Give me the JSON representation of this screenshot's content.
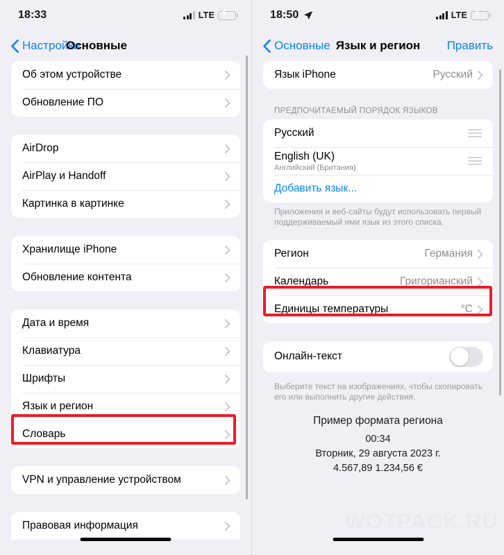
{
  "left_panel": {
    "status_bar": {
      "time": "18:33",
      "carrier": "LTE",
      "signal_bars_filled": 3,
      "signal_bars_total": 4,
      "battery_charging": true,
      "location_arrow": false
    },
    "nav": {
      "back_label": "Настройки",
      "title": "Основные",
      "action_label": ""
    },
    "groups": [
      {
        "rows": [
          {
            "label": "Об этом устройстве",
            "value": "",
            "accessory": "chevron"
          },
          {
            "label": "Обновление ПО",
            "value": "",
            "accessory": "chevron"
          }
        ]
      },
      {
        "rows": [
          {
            "label": "AirDrop",
            "value": "",
            "accessory": "chevron"
          },
          {
            "label": "AirPlay и Handoff",
            "value": "",
            "accessory": "chevron"
          },
          {
            "label": "Картинка в картинке",
            "value": "",
            "accessory": "chevron"
          }
        ]
      },
      {
        "rows": [
          {
            "label": "Хранилище iPhone",
            "value": "",
            "accessory": "chevron"
          },
          {
            "label": "Обновление контента",
            "value": "",
            "accessory": "chevron"
          }
        ]
      },
      {
        "rows": [
          {
            "label": "Дата и время",
            "value": "",
            "accessory": "chevron"
          },
          {
            "label": "Клавиатура",
            "value": "",
            "accessory": "chevron"
          },
          {
            "label": "Шрифты",
            "value": "",
            "accessory": "chevron"
          },
          {
            "label": "Язык и регион",
            "value": "",
            "accessory": "chevron",
            "highlighted": true
          },
          {
            "label": "Словарь",
            "value": "",
            "accessory": "chevron"
          }
        ]
      },
      {
        "rows": [
          {
            "label": "VPN и управление устройством",
            "value": "",
            "accessory": "chevron"
          }
        ]
      },
      {
        "rows": [
          {
            "label": "Правовая информация",
            "value": "",
            "accessory": "chevron"
          }
        ]
      }
    ]
  },
  "right_panel": {
    "status_bar": {
      "time": "18:50",
      "carrier": "LTE",
      "signal_bars_filled": 4,
      "signal_bars_total": 4,
      "battery_charging": true,
      "location_arrow": true
    },
    "nav": {
      "back_label": "Основные",
      "title": "Язык и регион",
      "action_label": "Править"
    },
    "iphone_language": {
      "label": "Язык iPhone",
      "value": "Русский"
    },
    "preferred_order": {
      "caption": "ПРЕДПОЧИТАЕМЫЙ ПОРЯДОК ЯЗЫКОВ",
      "items": [
        {
          "label": "Русский",
          "sub": ""
        },
        {
          "label": "English (UK)",
          "sub": "Английский (Британия)"
        }
      ],
      "add_language_label": "Добавить язык...",
      "footnote": "Приложения и веб-сайты будут использовать первый поддерживаемый ими язык из этого списка."
    },
    "region_group": {
      "rows": [
        {
          "label": "Регион",
          "value": "Германия",
          "highlighted": true
        },
        {
          "label": "Календарь",
          "value": "Григорианский"
        },
        {
          "label": "Единицы температуры",
          "value": "°C"
        }
      ]
    },
    "live_text": {
      "label": "Онлайн-текст",
      "enabled": false,
      "footnote": "Выберите текст на изображениях, чтобы скопировать его или выполнить другие действия."
    },
    "region_sample": {
      "title": "Пример формата региона",
      "time": "00:34",
      "date": "Вторник, 29 августа 2023 г.",
      "numbers": "4.567,89 1.234,56 €"
    }
  },
  "watermark": "WOTPACK.RU",
  "colors": {
    "accent_blue": "#0a84ff",
    "highlight_red": "#ee1c25",
    "background_gray": "#f0eff5",
    "card_white": "#ffffff",
    "secondary_text": "#8e8e93",
    "toggle_green": "#34c759"
  }
}
